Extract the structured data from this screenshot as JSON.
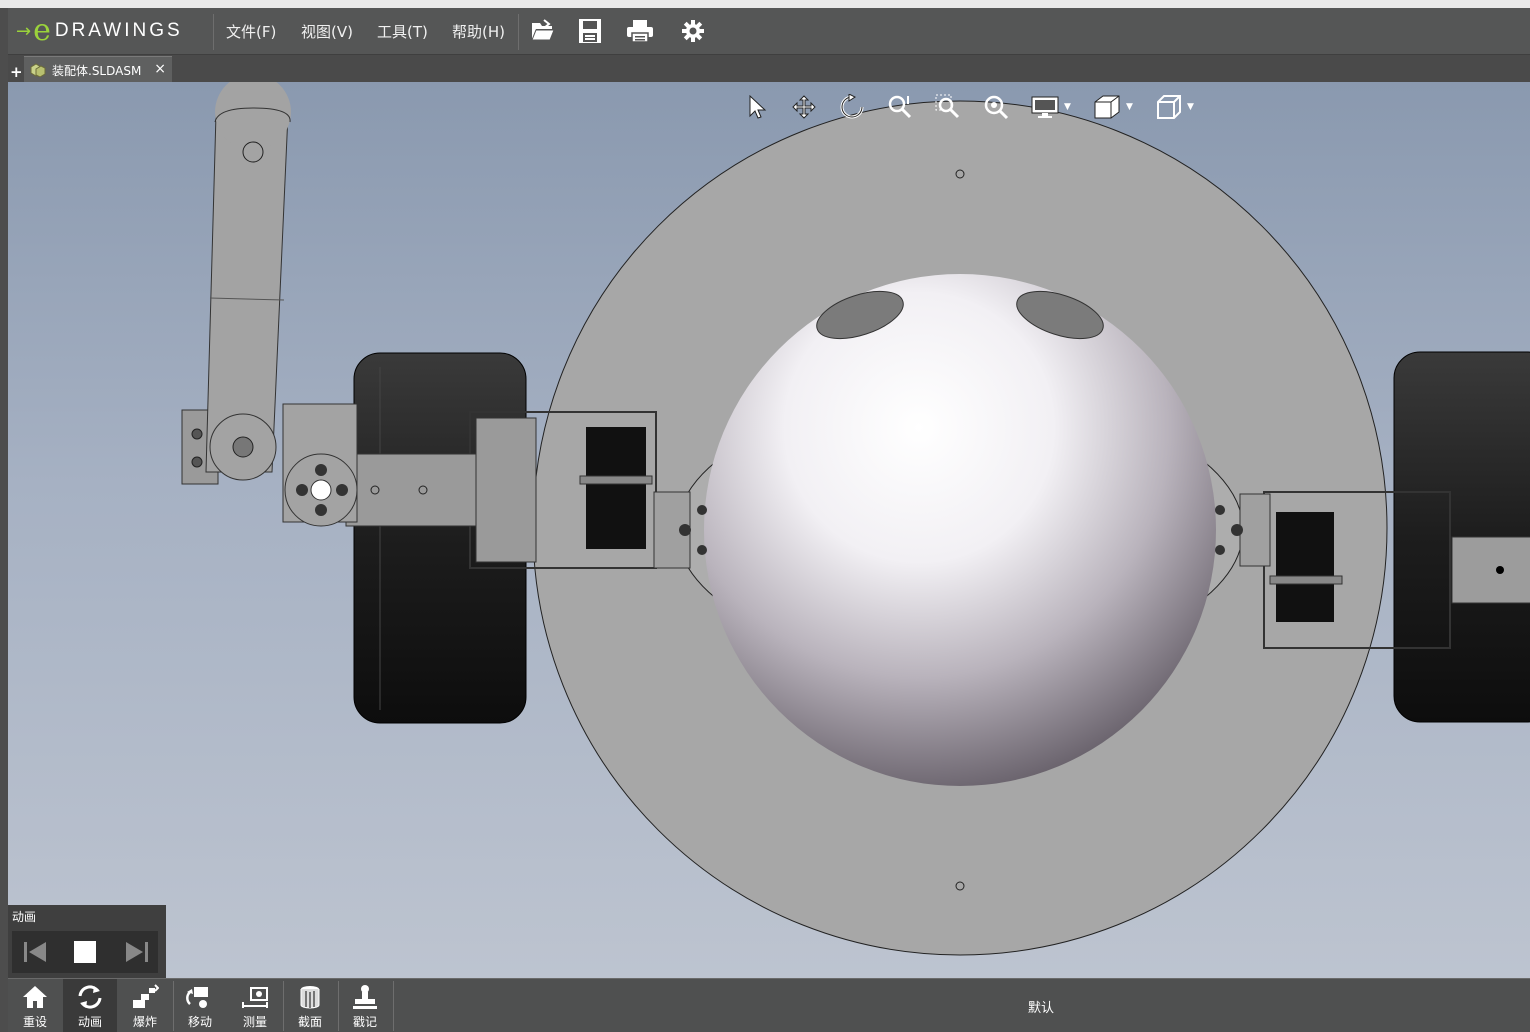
{
  "app": {
    "logo_text": "DRAWINGS",
    "logo_letter": "e"
  },
  "menu": [
    "文件(F)",
    "视图(V)",
    "工具(T)",
    "帮助(H)"
  ],
  "toolbar_icons": [
    "open-file-icon",
    "save-icon",
    "print-icon",
    "settings-gear-icon"
  ],
  "tabs": [
    {
      "label": "装配体.SLDASM",
      "close": "×"
    }
  ],
  "tab_add": "+",
  "view_toolbar_icons": [
    "select-arrow-icon",
    "pan-icon",
    "rotate-icon",
    "zoom-fit-icon",
    "zoom-area-icon",
    "zoom-icon",
    "display-style-icon",
    "section-view-icon",
    "view-orientation-cube-icon"
  ],
  "animation_panel": {
    "title": "动画"
  },
  "bottom_tools": [
    {
      "label": "重设",
      "icon": "home-icon"
    },
    {
      "label": "动画",
      "icon": "animation-icon"
    },
    {
      "label": "爆炸",
      "icon": "explode-icon"
    },
    {
      "label": "移动",
      "icon": "move-icon"
    },
    {
      "label": "测量",
      "icon": "measure-icon"
    },
    {
      "label": "截面",
      "icon": "section-icon"
    },
    {
      "label": "戳记",
      "icon": "stamp-icon"
    }
  ],
  "status": {
    "configuration": "默认"
  },
  "colors": {
    "bar": "#555656",
    "accent_green": "#9bd33b",
    "viewport_top": "#8a99af",
    "viewport_bottom": "#bdc4d0"
  }
}
